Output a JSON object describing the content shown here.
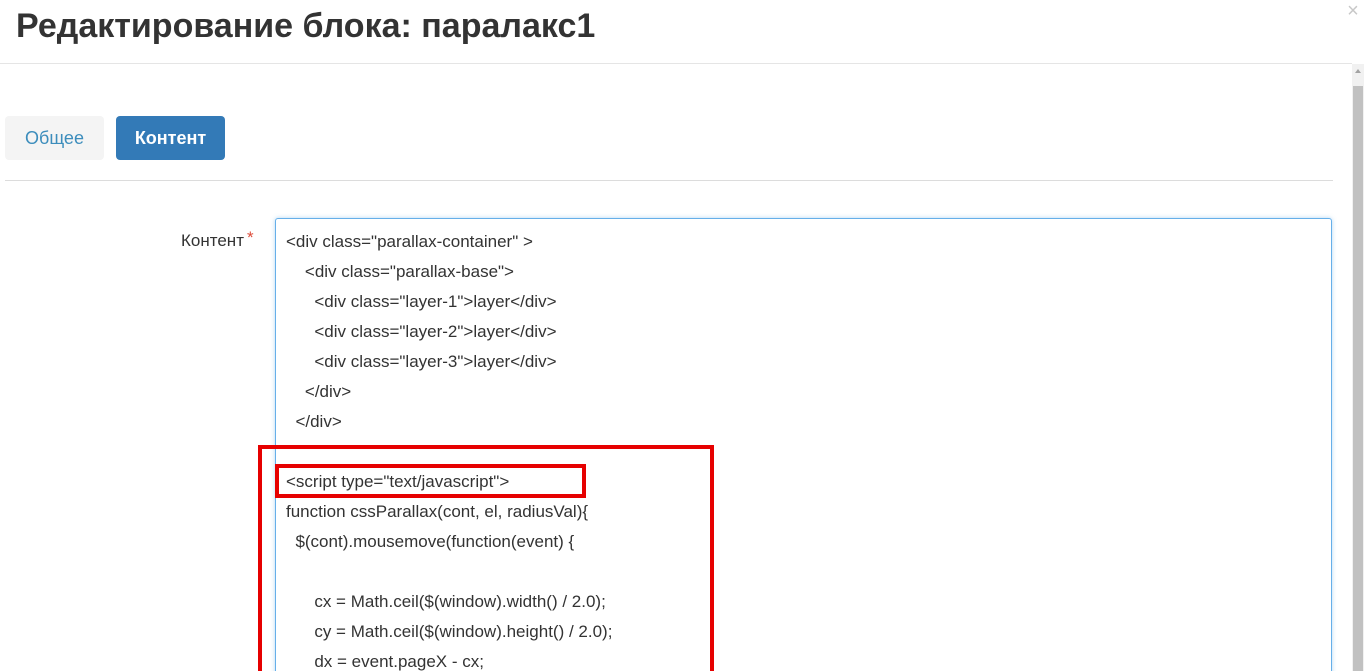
{
  "modal": {
    "title": "Редактирование блока: паралакс1",
    "close_glyph": "×"
  },
  "tabs": [
    {
      "label": "Общее",
      "active": false
    },
    {
      "label": "Контент",
      "active": true
    }
  ],
  "form": {
    "content_label": "Контент",
    "required_marker": "*",
    "content_lines": [
      "<div class=\"parallax-container\" >",
      "    <div class=\"parallax-base\">",
      "      <div class=\"layer-1\">layer</div>",
      "      <div class=\"layer-2\">layer</div>",
      "      <div class=\"layer-3\">layer</div>",
      "    </div>",
      "  </div>",
      "",
      "<script type=\"text/javascript\">",
      "function cssParallax(cont, el, radiusVal){",
      "  $(cont).mousemove(function(event) {",
      "",
      "      cx = Math.ceil($(window).width() / 2.0);",
      "      cy = Math.ceil($(window).height() / 2.0);",
      "      dx = event.pageX - cx;"
    ]
  },
  "colors": {
    "primary": "#337ab7",
    "link": "#3c8dbc",
    "highlight": "#e60000",
    "required": "#dd4b39",
    "focus_border": "#66afe9"
  }
}
